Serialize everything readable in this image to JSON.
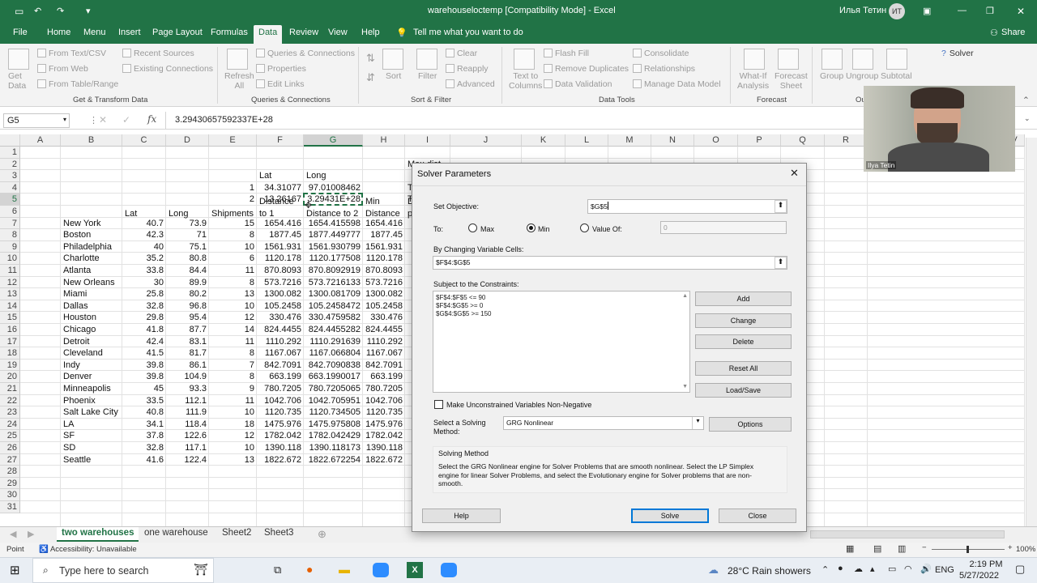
{
  "titlebar": {
    "document_title": "warehouseloctemp  [Compatibility Mode]  -  Excel",
    "user_name": "Илья Тетин",
    "user_initials": "ИТ"
  },
  "ribbon_tabs": [
    "File",
    "Home",
    "Menu",
    "Insert",
    "Page Layout",
    "Formulas",
    "Data",
    "Review",
    "View",
    "Help"
  ],
  "active_tab": "Data",
  "tell_me": "Tell me what you want to do",
  "share_label": "Share",
  "ribbon": {
    "get_data": "Get\nData",
    "from_text_csv": "From Text/CSV",
    "from_web": "From Web",
    "from_table_range": "From Table/Range",
    "recent_sources": "Recent Sources",
    "existing_connections": "Existing Connections",
    "group_get_transform": "Get & Transform Data",
    "refresh_all": "Refresh\nAll",
    "queries_connections": "Queries & Connections",
    "properties": "Properties",
    "edit_links": "Edit Links",
    "group_queries": "Queries & Connections",
    "sort": "Sort",
    "filter": "Filter",
    "clear": "Clear",
    "reapply": "Reapply",
    "advanced": "Advanced",
    "group_sort_filter": "Sort & Filter",
    "text_to_columns": "Text to\nColumns",
    "flash_fill": "Flash Fill",
    "remove_duplicates": "Remove Duplicates",
    "data_validation": "Data Validation",
    "consolidate": "Consolidate",
    "relationships": "Relationships",
    "manage_data_model": "Manage Data Model",
    "group_data_tools": "Data Tools",
    "what_if": "What-If\nAnalysis",
    "forecast_sheet": "Forecast\nSheet",
    "group_forecast": "Forecast",
    "group": "Group",
    "ungroup": "Ungroup",
    "subtotal": "Subtotal",
    "group_outline": "Ou",
    "solver": "Solver"
  },
  "formula_bar": {
    "name_box": "G5",
    "formula": "3.29430657592337E+28"
  },
  "columns": [
    "A",
    "B",
    "C",
    "D",
    "E",
    "F",
    "G",
    "H",
    "I",
    "J",
    "K",
    "L",
    "M",
    "N",
    "O",
    "P",
    "Q",
    "R",
    "V"
  ],
  "rows": [
    "1",
    "2",
    "3",
    "4",
    "5",
    "6",
    "7",
    "8",
    "9",
    "10",
    "11",
    "12",
    "13",
    "14",
    "15",
    "16",
    "17",
    "18",
    "19",
    "20",
    "21",
    "22",
    "23",
    "24",
    "25",
    "26",
    "27",
    "28",
    "29",
    "30",
    "31"
  ],
  "sheet": {
    "I2": "Max dist",
    "F3": "Lat",
    "G3": "Long",
    "E4": "1",
    "F4": "34.31077",
    "G4": "97.01008462",
    "I4": "T",
    "E5": "2",
    "F5": "13.26167",
    "G5": "3.29431E+28",
    "I5": "T",
    "F6a": "Distance",
    "F6b": "to 1",
    "G6": "Distance to 2",
    "H6a": "Min",
    "H6b": "Distance",
    "I6a": "D",
    "I6b": "p",
    "C6": "Lat",
    "D6": "Long",
    "E6": "Shipments",
    "data": [
      [
        "New York",
        "40.7",
        "73.9",
        "15",
        "1654.416",
        "1654.415598",
        "1654.416"
      ],
      [
        "Boston",
        "42.3",
        "71",
        "8",
        "1877.45",
        "1877.449777",
        "1877.45"
      ],
      [
        "Philadelphia",
        "40",
        "75.1",
        "10",
        "1561.931",
        "1561.930799",
        "1561.931"
      ],
      [
        "Charlotte",
        "35.2",
        "80.8",
        "6",
        "1120.178",
        "1120.177508",
        "1120.178"
      ],
      [
        "Atlanta",
        "33.8",
        "84.4",
        "11",
        "870.8093",
        "870.8092919",
        "870.8093"
      ],
      [
        "New Orleans",
        "30",
        "89.9",
        "8",
        "573.7216",
        "573.7216133",
        "573.7216"
      ],
      [
        "Miami",
        "25.8",
        "80.2",
        "13",
        "1300.082",
        "1300.081709",
        "1300.082"
      ],
      [
        "Dallas",
        "32.8",
        "96.8",
        "10",
        "105.2458",
        "105.2458472",
        "105.2458"
      ],
      [
        "Houston",
        "29.8",
        "95.4",
        "12",
        "330.476",
        "330.4759582",
        "330.476"
      ],
      [
        "Chicago",
        "41.8",
        "87.7",
        "14",
        "824.4455",
        "824.4455282",
        "824.4455"
      ],
      [
        "Detroit",
        "42.4",
        "83.1",
        "11",
        "1110.292",
        "1110.291639",
        "1110.292"
      ],
      [
        "Cleveland",
        "41.5",
        "81.7",
        "8",
        "1167.067",
        "1167.066804",
        "1167.067"
      ],
      [
        "Indy",
        "39.8",
        "86.1",
        "7",
        "842.7091",
        "842.7090838",
        "842.7091"
      ],
      [
        "Denver",
        "39.8",
        "104.9",
        "8",
        "663.199",
        "663.1990017",
        "663.199"
      ],
      [
        "Minneapolis",
        "45",
        "93.3",
        "9",
        "780.7205",
        "780.7205065",
        "780.7205"
      ],
      [
        "Phoenix",
        "33.5",
        "112.1",
        "11",
        "1042.706",
        "1042.705951",
        "1042.706"
      ],
      [
        "Salt Lake City",
        "40.8",
        "111.9",
        "10",
        "1120.735",
        "1120.734505",
        "1120.735"
      ],
      [
        "LA",
        "34.1",
        "118.4",
        "18",
        "1475.976",
        "1475.975808",
        "1475.976"
      ],
      [
        "SF",
        "37.8",
        "122.6",
        "12",
        "1782.042",
        "1782.042429",
        "1782.042"
      ],
      [
        "SD",
        "32.8",
        "117.1",
        "10",
        "1390.118",
        "1390.118173",
        "1390.118"
      ],
      [
        "Seattle",
        "41.6",
        "122.4",
        "13",
        "1822.672",
        "1822.672254",
        "1822.672"
      ]
    ]
  },
  "sheet_tabs": [
    "two warehouses",
    "one warehouse",
    "Sheet2",
    "Sheet3"
  ],
  "active_sheet": "two warehouses",
  "status": {
    "mode": "Point",
    "accessibility": "Accessibility: Unavailable",
    "zoom": "100%"
  },
  "dialog": {
    "title": "Solver Parameters",
    "set_objective_label": "Set Objective:",
    "objective_value": "$G$5",
    "to_label": "To:",
    "max_label": "Max",
    "min_label": "Min",
    "value_of_label": "Value Of:",
    "value_of_value": "0",
    "selected_goal": "Min",
    "changing_cells_label": "By Changing Variable Cells:",
    "changing_cells_value": "$F$4:$G$5",
    "constraints_label": "Subject to the Constraints:",
    "constraints": [
      "$F$4:$F$5 <= 90",
      "$F$4:$G$5 >= 0",
      "$G$4:$G$5 >= 150"
    ],
    "add": "Add",
    "change": "Change",
    "delete": "Delete",
    "reset_all": "Reset All",
    "load_save": "Load/Save",
    "unconstrained_label": "Make Unconstrained Variables Non-Negative",
    "unconstrained_checked": false,
    "solving_method_label": "Select a Solving Method:",
    "solving_method_value": "GRG Nonlinear",
    "options": "Options",
    "solving_method_title": "Solving Method",
    "solving_method_text": "Select the GRG Nonlinear engine for Solver Problems that are smooth nonlinear. Select the LP Simplex engine for linear Solver Problems, and select the Evolutionary engine for Solver problems that are non-smooth.",
    "help": "Help",
    "solve": "Solve",
    "close": "Close"
  },
  "webcam": {
    "name": "Ilya Tetin"
  },
  "taskbar": {
    "search_placeholder": "Type here to search",
    "weather": "28°C  Rain showers",
    "language": "ENG",
    "time": "2:19 PM",
    "date": "5/27/2022"
  },
  "colors": {
    "excel_green": "#217346",
    "dialog_bg": "#f0f0f0",
    "selected_cell_border": "#217346"
  }
}
